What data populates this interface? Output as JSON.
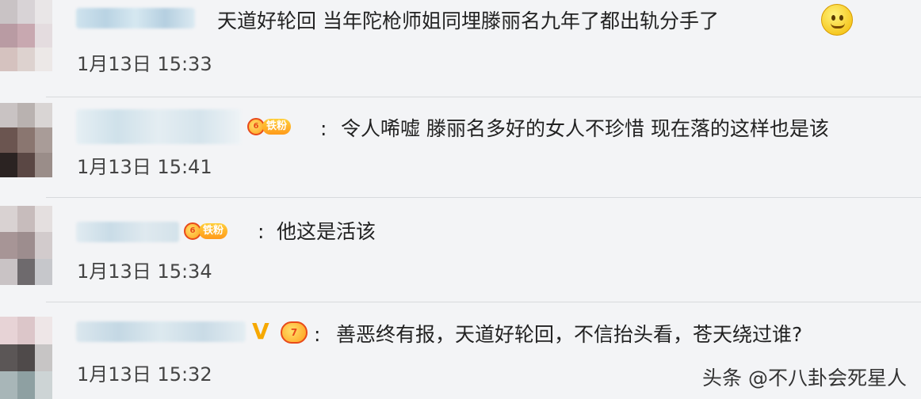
{
  "comments": [
    {
      "text": "天道好轮回 当年陀枪师姐同埋滕丽名九年了都出轨分手了",
      "time": "1月13日 15:33",
      "emoji": "smiling-face-emoji"
    },
    {
      "colon": ":",
      "text": "令人唏嘘 滕丽名多好的女人不珍惜 现在落的这样也是该",
      "time": "1月13日 15:41",
      "badge_level": "6",
      "badge_label": "铁粉"
    },
    {
      "colon": ":",
      "text": "他这是活该",
      "time": "1月13日 15:34",
      "badge_level": "6",
      "badge_label": "铁粉"
    },
    {
      "colon": ":",
      "text": "善恶终有报，天道好轮回，不信抬头看，苍天绕过谁?",
      "time": "1月13日 15:32",
      "badge_level": "7",
      "v_mark": "V"
    }
  ],
  "watermark": "头条 @不八卦会死星人"
}
